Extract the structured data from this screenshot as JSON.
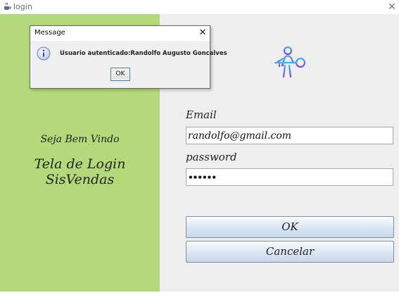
{
  "window": {
    "title": "login",
    "close_glyph": "✕",
    "icon": "java-cup-icon"
  },
  "left_panel": {
    "background": "#b3d97a",
    "welcome": "Seja Bem Vindo",
    "screen_title": "Tela de Login SisVendas"
  },
  "form": {
    "logo_icon": "person-key-icon",
    "email_label": "Email",
    "email_value": "randolfo@gmail.com",
    "password_label": "password",
    "password_value": "••••••",
    "ok_label": "OK",
    "cancel_label": "Cancelar"
  },
  "dialog": {
    "title": "Message",
    "close_glyph": "✕",
    "icon": "info-icon",
    "message": "Usuario autenticado:Randolfo Augusto Goncalves",
    "ok_label": "OK"
  }
}
